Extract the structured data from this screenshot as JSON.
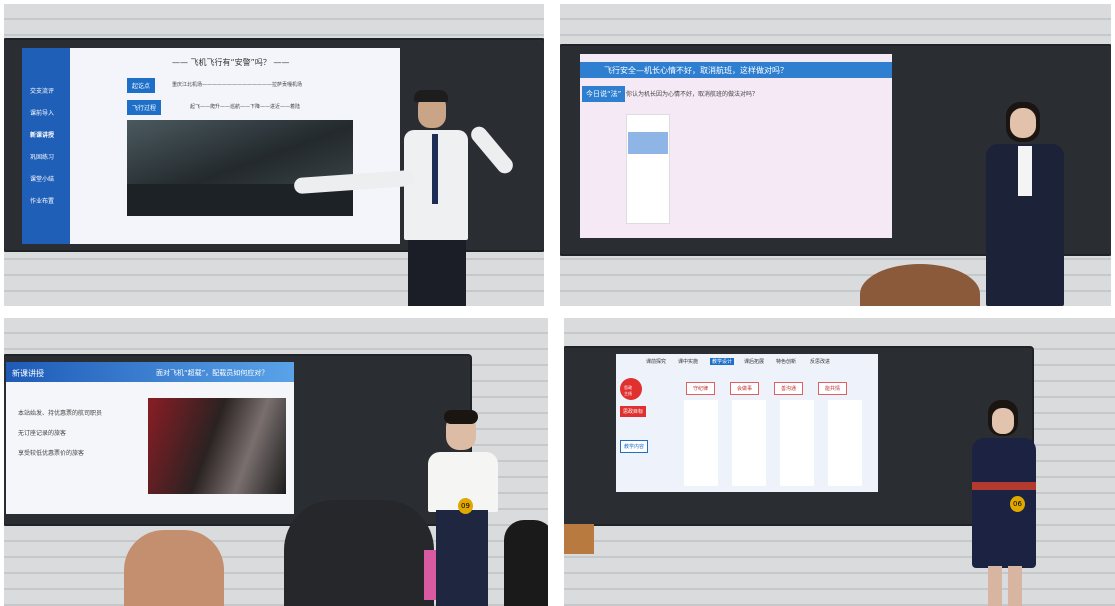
{
  "photos": [
    {
      "slide_title": "—— 飞机飞行有“安警”吗？ ——",
      "sidebar": [
        "交支流评",
        "课前导入",
        "新课讲授",
        "巩固练习",
        "课堂小结",
        "作业布置"
      ],
      "rows": [
        {
          "tag": "起讫点",
          "text": "重庆江北机场——————————————拉萨贡嘎机场"
        },
        {
          "tag": "飞行过程",
          "text": "起飞——爬升——巡航——下降——进近——着陆"
        }
      ]
    },
    {
      "slide_title": "飞行安全—机长心情不好，取消航班，这样做对吗？",
      "question_tag": "今日说“法”",
      "question": "你认为机长因为心情不好，取消航班的做法对吗？"
    },
    {
      "slide_tab": "新课讲授",
      "slide_title": "面对飞机“超载”，配载员如何应对？",
      "bullets": [
        "本站始发、持优惠票的航司职员",
        "无订座记录的旅客",
        "享受较低优惠票价的旅客"
      ],
      "badge": "09"
    },
    {
      "nav": [
        "课前探究",
        "课中实施",
        "教学设计",
        "课后拓展",
        "特色创新",
        "反思改进"
      ],
      "center": "思政\n主线",
      "boxes": [
        "守纪律",
        "会做事",
        "善沟通",
        "能共情"
      ],
      "left_labels": [
        "思政目标",
        "教学内容"
      ],
      "badge": "06"
    }
  ],
  "colors": {
    "accent": "#1e6fc8",
    "badge": "#e0a800",
    "slide_bg": "#f3f4f8",
    "banner": "#2e7fd0"
  }
}
